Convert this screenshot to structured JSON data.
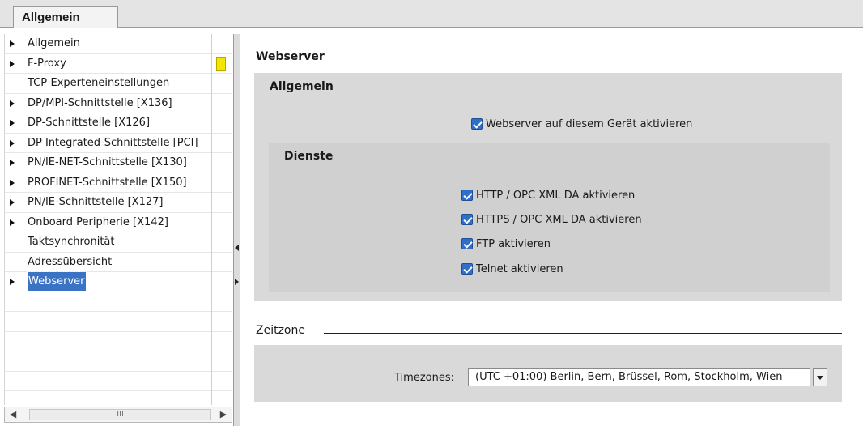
{
  "tab": {
    "label": "Allgemein"
  },
  "nav": {
    "items": [
      {
        "label": "Allgemein",
        "arrow": true
      },
      {
        "label": "F-Proxy",
        "arrow": true
      },
      {
        "label": "TCP-Experteneinstellungen",
        "arrow": false
      },
      {
        "label": "DP/MPI-Schnittstelle [X136]",
        "arrow": true
      },
      {
        "label": "DP-Schnittstelle [X126]",
        "arrow": true
      },
      {
        "label": "DP Integrated-Schnittstelle [PCI]",
        "arrow": true
      },
      {
        "label": "PN/IE-NET-Schnittstelle [X130]",
        "arrow": true
      },
      {
        "label": "PROFINET-Schnittstelle [X150]",
        "arrow": true
      },
      {
        "label": "PN/IE-Schnittstelle [X127]",
        "arrow": true
      },
      {
        "label": "Onboard Peripherie [X142]",
        "arrow": true
      },
      {
        "label": "Taktsynchronität",
        "arrow": false
      },
      {
        "label": "Adressübersicht",
        "arrow": false
      },
      {
        "label": "Webserver",
        "arrow": true,
        "selected": true
      }
    ],
    "scroll_grip": "III"
  },
  "webserver": {
    "title": "Webserver",
    "allgemein_title": "Allgemein",
    "enable_label": "Webserver auf diesem Gerät aktivieren",
    "dienste_title": "Dienste",
    "services": [
      "HTTP / OPC XML DA aktivieren",
      "HTTPS / OPC XML DA aktivieren",
      "FTP aktivieren",
      "Telnet aktivieren"
    ]
  },
  "zeitzone": {
    "title": "Zeitzone",
    "label": "Timezones:",
    "value": "(UTC +01:00) Berlin, Bern, Brüssel, Rom, Stockholm, Wien"
  },
  "colors": {
    "selection": "#3a73c4",
    "checkbox": "#2f6fc9",
    "marker": "#f5e600"
  }
}
